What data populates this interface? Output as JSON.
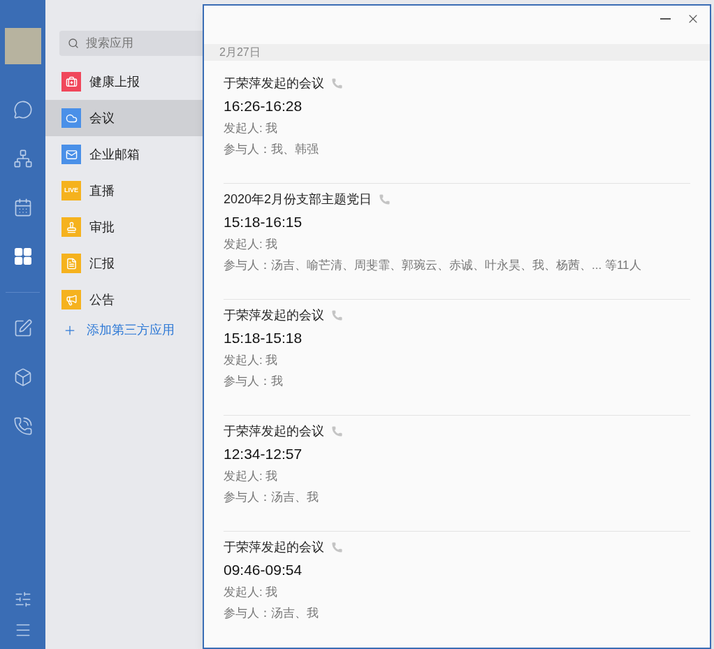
{
  "rail": {
    "items": [
      {
        "kind": "chat",
        "selected": false
      },
      {
        "kind": "org",
        "selected": false
      },
      {
        "kind": "calendar",
        "selected": false
      },
      {
        "kind": "apps",
        "selected": true
      },
      {
        "kind": "divider"
      },
      {
        "kind": "doc",
        "selected": false
      },
      {
        "kind": "box",
        "selected": false
      },
      {
        "kind": "cloud-phone",
        "selected": false
      }
    ],
    "bottom": [
      {
        "kind": "settings"
      },
      {
        "kind": "menu"
      }
    ]
  },
  "apps": {
    "search": {
      "placeholder": "搜索应用"
    },
    "items": [
      {
        "label": "健康上报",
        "kind": "health",
        "color": "#f0475b",
        "selected": false
      },
      {
        "label": "会议",
        "kind": "meeting",
        "color": "#4a90e8",
        "selected": true
      },
      {
        "label": "企业邮箱",
        "kind": "mail",
        "color": "#4a90e8",
        "selected": false
      },
      {
        "label": "直播",
        "kind": "live",
        "color": "#f5b21e",
        "badge": "LIVE",
        "selected": false
      },
      {
        "label": "审批",
        "kind": "stamp",
        "color": "#f5b21e",
        "selected": false
      },
      {
        "label": "汇报",
        "kind": "report",
        "color": "#f5b21e",
        "selected": false
      },
      {
        "label": "公告",
        "kind": "notice",
        "color": "#f5b21e",
        "selected": false
      }
    ],
    "add_link": "添加第三方应用"
  },
  "dialog": {
    "date": "2月27日",
    "meetings": [
      {
        "title": "于荣萍发起的会议",
        "time": "16:26-16:28",
        "initiator": "发起人: 我",
        "participants": "参与人：我、韩强"
      },
      {
        "title": "2020年2月份支部主题党日",
        "time": "15:18-16:15",
        "initiator": "发起人: 我",
        "participants": "参与人：汤吉、喻芒清、周斐霏、郭琬云、赤诚、叶永昊、我、杨茜、... 等11人"
      },
      {
        "title": "于荣萍发起的会议",
        "time": "15:18-15:18",
        "initiator": "发起人: 我",
        "participants": "参与人：我"
      },
      {
        "title": "于荣萍发起的会议",
        "time": "12:34-12:57",
        "initiator": "发起人: 我",
        "participants": "参与人：汤吉、我"
      },
      {
        "title": "于荣萍发起的会议",
        "time": "09:46-09:54",
        "initiator": "发起人: 我",
        "participants": "参与人：汤吉、我"
      }
    ]
  }
}
